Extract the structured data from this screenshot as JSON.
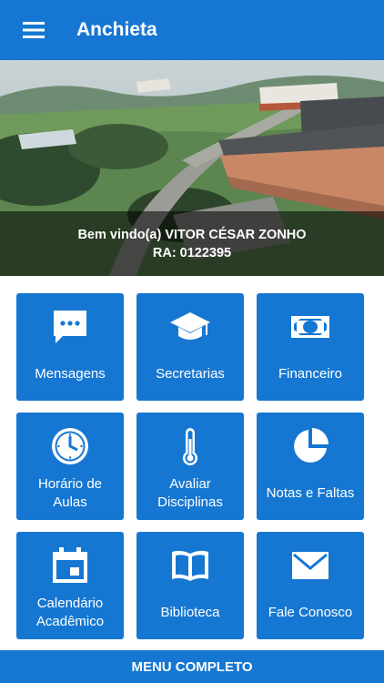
{
  "app": {
    "title": "Anchieta",
    "menu_icon": "hamburger-menu-icon",
    "accent": "#1677d2"
  },
  "hero": {
    "welcome": "Bem vindo(a) VITOR CÉSAR ZONHO",
    "ra": "RA: 0122395"
  },
  "tiles": [
    {
      "label": "Mensagens",
      "icon": "chat-bubble-icon"
    },
    {
      "label": "Secretarias",
      "icon": "graduation-cap-icon"
    },
    {
      "label": "Financeiro",
      "icon": "banknote-icon"
    },
    {
      "label": "Horário de Aulas",
      "icon": "clock-icon"
    },
    {
      "label": "Avaliar Disciplinas",
      "icon": "thermometer-icon"
    },
    {
      "label": "Notas e Faltas",
      "icon": "pie-chart-icon"
    },
    {
      "label": "Calendário Acadêmico",
      "icon": "calendar-icon"
    },
    {
      "label": "Biblioteca",
      "icon": "open-book-icon"
    },
    {
      "label": "Fale Conosco",
      "icon": "envelope-icon"
    }
  ],
  "footer": {
    "menu_completo": "MENU COMPLETO"
  }
}
